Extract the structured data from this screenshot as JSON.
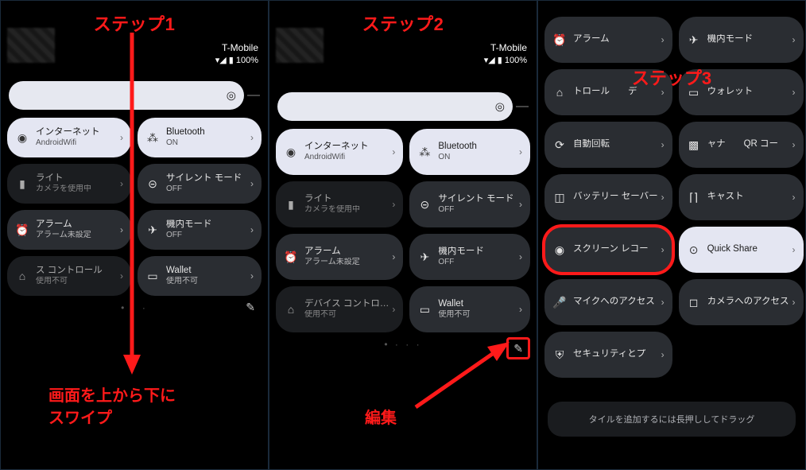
{
  "steps": {
    "s1": "ステップ1",
    "s2": "ステップ2",
    "s3": "ステップ3"
  },
  "status": {
    "carrier": "T-Mobile",
    "battery": "100%",
    "signal_glyph": "▾◢ ▮"
  },
  "annotations": {
    "swipe": "画面を上から下に\nスワイプ",
    "edit": "編集",
    "add_hint": "タイルを追加するには長押ししてドラッグ"
  },
  "tiles1": [
    {
      "icon": "wifi",
      "title": "インターネット",
      "sub": "AndroidWifi",
      "style": "light"
    },
    {
      "icon": "bt",
      "title": "Bluetooth",
      "sub": "ON",
      "style": "light"
    },
    {
      "icon": "flash",
      "title": "ライト",
      "sub": "カメラを使用中",
      "style": "dark"
    },
    {
      "icon": "silent",
      "title": "サイレント モード",
      "sub": "OFF",
      "style": "tile"
    },
    {
      "icon": "alarm",
      "title": "アラーム",
      "sub": "アラーム未設定",
      "style": "tile"
    },
    {
      "icon": "plane",
      "title": "機内モード",
      "sub": "OFF",
      "style": "tile"
    },
    {
      "icon": "home",
      "title": "ス コントロール",
      "sub": "使用不可",
      "style": "dark"
    },
    {
      "icon": "card",
      "title": "Wallet",
      "sub": "使用不可",
      "style": "tile"
    }
  ],
  "tiles2": [
    {
      "icon": "wifi",
      "title": "インターネット",
      "sub": "AndroidWifi",
      "style": "light"
    },
    {
      "icon": "bt",
      "title": "Bluetooth",
      "sub": "ON",
      "style": "light"
    },
    {
      "icon": "flash",
      "title": "ライト",
      "sub": "カメラを使用中",
      "style": "dark"
    },
    {
      "icon": "silent",
      "title": "サイレント モード",
      "sub": "OFF",
      "style": "tile"
    },
    {
      "icon": "alarm",
      "title": "アラーム",
      "sub": "アラーム未設定",
      "style": "tile"
    },
    {
      "icon": "plane",
      "title": "機内モード",
      "sub": "OFF",
      "style": "tile"
    },
    {
      "icon": "home",
      "title": "デバイス コントロ…",
      "sub": "使用不可",
      "style": "dark"
    },
    {
      "icon": "card",
      "title": "Wallet",
      "sub": "使用不可",
      "style": "tile"
    }
  ],
  "tiles3": [
    {
      "icon": "alarm",
      "title": "アラーム",
      "sub": "",
      "style": "tile"
    },
    {
      "icon": "plane",
      "title": "機内モード",
      "sub": "",
      "style": "tile"
    },
    {
      "icon": "home",
      "title": "トロール　　デ",
      "sub": "",
      "style": "tile"
    },
    {
      "icon": "card",
      "title": "ウォレット",
      "sub": "",
      "style": "tile"
    },
    {
      "icon": "rotate",
      "title": "自動回転",
      "sub": "",
      "style": "tile"
    },
    {
      "icon": "qr",
      "title": "ャナ　　QR コー",
      "sub": "",
      "style": "tile"
    },
    {
      "icon": "battery",
      "title": "バッテリー セーバー",
      "sub": "",
      "style": "tile"
    },
    {
      "icon": "cast",
      "title": "キャスト",
      "sub": "",
      "style": "tile"
    },
    {
      "icon": "record",
      "title": "スクリーン レコー",
      "sub": "",
      "style": "tile",
      "highlight": true
    },
    {
      "icon": "share",
      "title": "Quick Share",
      "sub": "",
      "style": "light"
    },
    {
      "icon": "mic",
      "title": "マイクへのアクセス",
      "sub": "",
      "style": "tile"
    },
    {
      "icon": "camera",
      "title": "カメラへのアクセス",
      "sub": "",
      "style": "tile"
    },
    {
      "icon": "shield",
      "title": "セキュリティとプ",
      "sub": "",
      "style": "tile"
    }
  ],
  "icons": {
    "wifi": "◉",
    "bt": "⁂",
    "flash": "▮",
    "silent": "⊝",
    "alarm": "⏰",
    "plane": "✈",
    "home": "⌂",
    "card": "▭",
    "rotate": "⟳",
    "qr": "▩",
    "battery": "◫",
    "cast": "⌈⌉",
    "record": "◉",
    "share": "⊙",
    "mic": "🎤",
    "camera": "◻",
    "shield": "⛨",
    "edit": "✎",
    "sun": "◎"
  }
}
